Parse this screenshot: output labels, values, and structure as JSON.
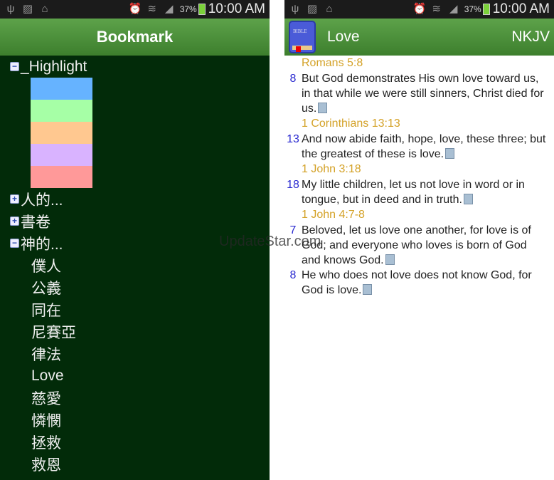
{
  "status": {
    "battery": "37%",
    "time": "10:00 AM"
  },
  "left": {
    "title": "Bookmark",
    "highlight": {
      "label": "_Highlight",
      "colors": [
        "#66b3ff",
        "#a6ffa6",
        "#ffc890",
        "#d9b3ff",
        "#ff9999"
      ]
    },
    "groups": [
      {
        "label": "人的...",
        "expanded": false
      },
      {
        "label": "書卷",
        "expanded": false
      },
      {
        "label": "神的...",
        "expanded": true
      }
    ],
    "children": [
      "僕人",
      "公義",
      "同在",
      "尼賽亞",
      "律法",
      "Love",
      "慈愛",
      "憐憫",
      "拯救",
      "救恩"
    ]
  },
  "right": {
    "title": "Love",
    "version": "NKJV",
    "icon_label": "BIBLE",
    "passages": [
      {
        "ref": "Romans 5:8",
        "verses": [
          {
            "num": "8",
            "text": "But God demonstrates His own love toward us, in that while we were still sinners, Christ died for us."
          }
        ]
      },
      {
        "ref": "1 Corinthians 13:13",
        "verses": [
          {
            "num": "13",
            "text": "And now abide faith, hope, love, these three; but the greatest of these is love."
          }
        ]
      },
      {
        "ref": "1 John 3:18",
        "verses": [
          {
            "num": "18",
            "text": "My little children, let us not love in word or in tongue, but in deed and in truth."
          }
        ]
      },
      {
        "ref": "1 John 4:7-8",
        "verses": [
          {
            "num": "7",
            "text": "Beloved, let us love one another, for love is of God; and everyone who loves is born of God and knows God."
          },
          {
            "num": "8",
            "text": "He who does not love does not know God, for God is love."
          }
        ]
      }
    ]
  },
  "watermark": "UpdateStar.com"
}
